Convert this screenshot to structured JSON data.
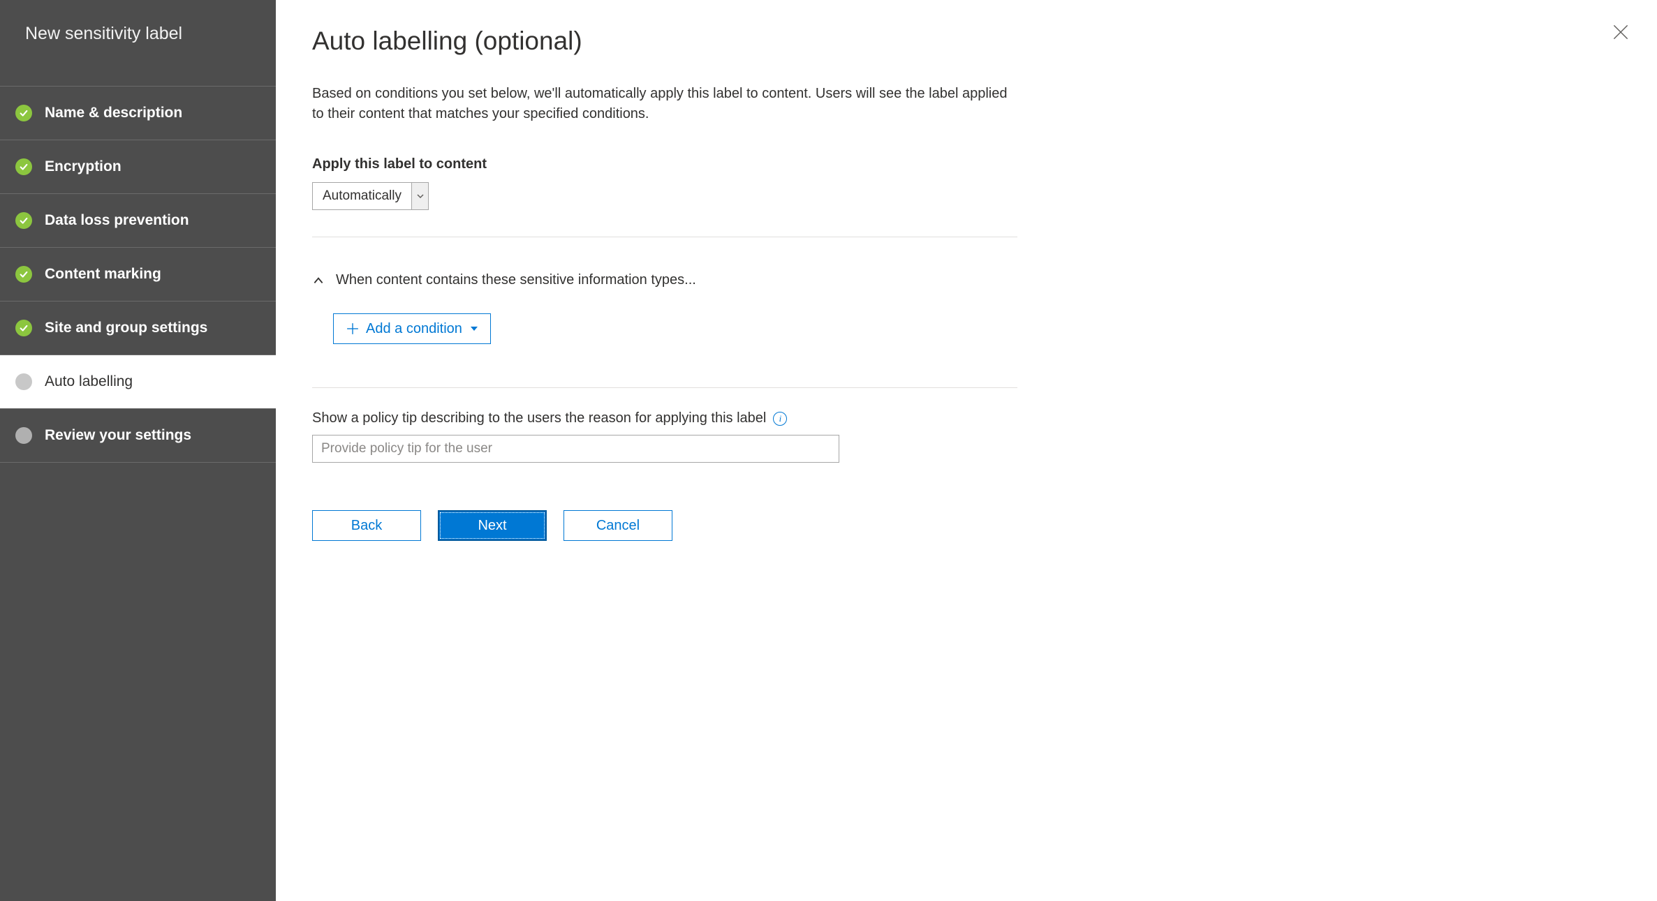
{
  "sidebar": {
    "title": "New sensitivity label",
    "steps": [
      {
        "label": "Name & description",
        "status": "done"
      },
      {
        "label": "Encryption",
        "status": "done"
      },
      {
        "label": "Data loss prevention",
        "status": "done"
      },
      {
        "label": "Content marking",
        "status": "done"
      },
      {
        "label": "Site and group settings",
        "status": "done"
      },
      {
        "label": "Auto labelling",
        "status": "current"
      },
      {
        "label": "Review your settings",
        "status": "pending"
      }
    ]
  },
  "main": {
    "heading": "Auto labelling (optional)",
    "description": "Based on conditions you set below, we'll automatically apply this label to content. Users will see the label applied to their content that matches your specified conditions.",
    "apply_label": "Apply this label to content",
    "apply_select_value": "Automatically",
    "condition_header": "When content contains these sensitive information types...",
    "add_condition_label": "Add a condition",
    "policy_tip_label": "Show a policy tip describing to the users the reason for applying this label",
    "policy_tip_placeholder": "Provide policy tip for the user",
    "policy_tip_value": ""
  },
  "buttons": {
    "back": "Back",
    "next": "Next",
    "cancel": "Cancel"
  }
}
